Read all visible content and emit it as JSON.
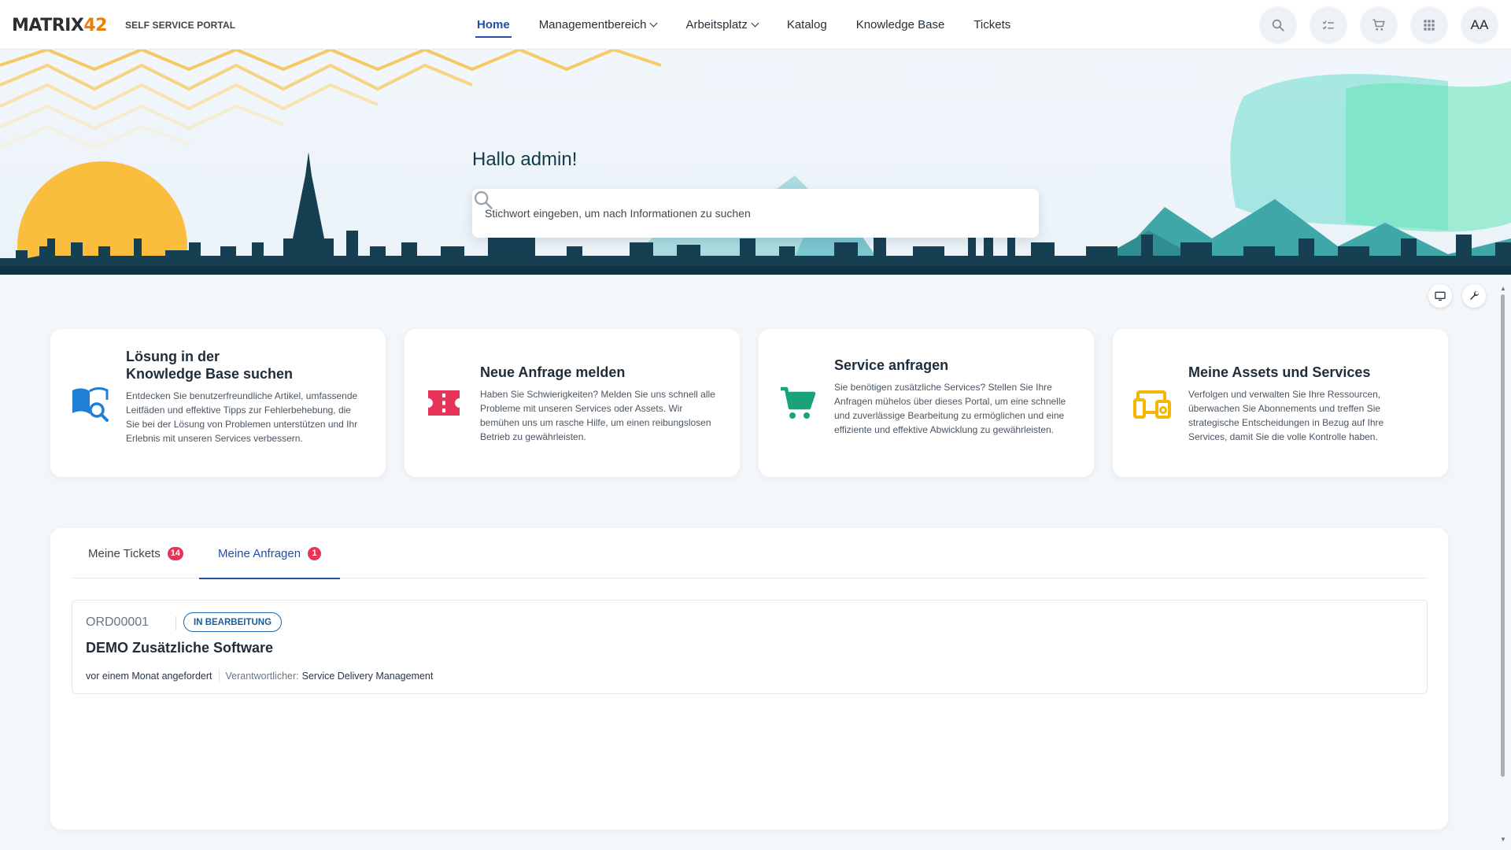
{
  "header": {
    "logo_main": "MATRIX",
    "logo_accent": "42",
    "portal_title": "SELF SERVICE PORTAL",
    "nav": [
      {
        "label": "Home",
        "active": true
      },
      {
        "label": "Managementbereich",
        "dropdown": true
      },
      {
        "label": "Arbeitsplatz",
        "dropdown": true
      },
      {
        "label": "Katalog"
      },
      {
        "label": "Knowledge Base"
      },
      {
        "label": "Tickets"
      }
    ],
    "icons": [
      "search-icon",
      "checklist-icon",
      "cart-icon",
      "apps-grid-icon"
    ],
    "avatar_initials": "AA"
  },
  "hero": {
    "greeting": "Hallo admin!",
    "search_placeholder": "Stichwort eingeben, um nach Informationen zu suchen"
  },
  "cards": [
    {
      "title_line1": "Lösung in der",
      "title_line2": "Knowledge Base suchen",
      "description": "Entdecken Sie benutzerfreundliche Artikel, umfassende Leitfäden und effektive Tipps zur Fehlerbehebung, die Sie bei der Lösung von Problemen unterstützen und Ihr Erlebnis mit unseren Services verbessern.",
      "icon": "knowledge-search-icon",
      "color": "#1e7fd6"
    },
    {
      "title": "Neue Anfrage melden",
      "description": "Haben Sie Schwierigkeiten? Melden Sie uns schnell alle Probleme mit unseren Services oder Assets. Wir bemühen uns um rasche Hilfe, um einen reibungslosen Betrieb zu gewährleisten.",
      "icon": "ticket-icon",
      "color": "#e7345b"
    },
    {
      "title": "Service anfragen",
      "description": "Sie benötigen zusätzliche Services? Stellen Sie Ihre Anfragen mühelos über dieses Portal, um eine schnelle und zuverlässige Bearbeitung zu ermöglichen und eine effiziente und effektive Abwicklung zu gewährleisten.",
      "icon": "cart-icon",
      "color": "#1aa27a"
    },
    {
      "title": "Meine Assets und Services",
      "description": "Verfolgen und verwalten Sie Ihre Ressourcen, überwachen Sie Abonnements und treffen Sie strategische Entscheidungen in Bezug auf Ihre Services, damit Sie die volle Kontrolle haben.",
      "icon": "devices-icon",
      "color": "#f2b705"
    }
  ],
  "tabs": [
    {
      "label": "Meine Tickets",
      "count": "14"
    },
    {
      "label": "Meine Anfragen",
      "count": "1",
      "active": true
    }
  ],
  "request": {
    "id": "ORD00001",
    "status": "IN BEARBEITUNG",
    "title": "DEMO Zusätzliche Software",
    "requested": "vor einem Monat angefordert",
    "responsible_label": "Verantwortlicher:",
    "responsible_value": "Service Delivery Management"
  }
}
